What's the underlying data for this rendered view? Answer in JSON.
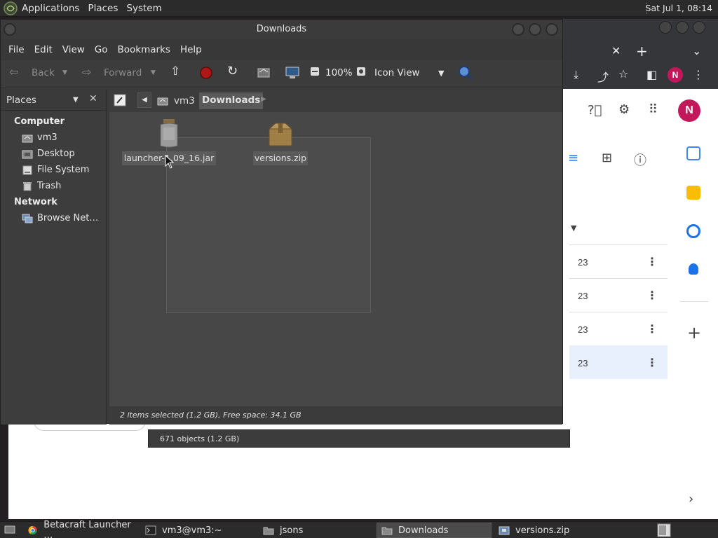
{
  "top_panel": {
    "menus": [
      "Applications",
      "Places",
      "System"
    ],
    "clock": "Sat Jul  1, 08:14"
  },
  "browser": {
    "avatar_letter": "N",
    "rows": [
      "23",
      "23",
      "23",
      "23"
    ]
  },
  "file_manager": {
    "title": "Downloads",
    "menubar": [
      "File",
      "Edit",
      "View",
      "Go",
      "Bookmarks",
      "Help"
    ],
    "toolbar": {
      "back": "Back",
      "forward": "Forward",
      "zoom": "100%",
      "view_mode": "Icon View"
    },
    "sidebar": {
      "header": "Places",
      "sections": [
        {
          "title": "Computer",
          "items": [
            "vm3",
            "Desktop",
            "File System",
            "Trash"
          ]
        },
        {
          "title": "Network",
          "items": [
            "Browse Net…"
          ]
        }
      ]
    },
    "path": [
      "vm3",
      "Downloads"
    ],
    "files": [
      {
        "name": "launcher-1.09_16.jar",
        "icon": "jar-icon"
      },
      {
        "name": "versions.zip",
        "icon": "archive-icon"
      }
    ],
    "status": "2 items selected (1.2 GB), Free space: 34.1 GB"
  },
  "second_window": {
    "status": "671 objects (1.2 GB)"
  },
  "taskbar": {
    "tasks": [
      {
        "label": "Betacraft Launcher …",
        "icon": "chrome-icon"
      },
      {
        "label": "vm3@vm3:~",
        "icon": "terminal-icon"
      },
      {
        "label": "jsons",
        "icon": "folder-icon"
      },
      {
        "label": "Downloads",
        "icon": "folder-icon"
      },
      {
        "label": "versions.zip",
        "icon": "archive-manager-icon"
      }
    ]
  }
}
